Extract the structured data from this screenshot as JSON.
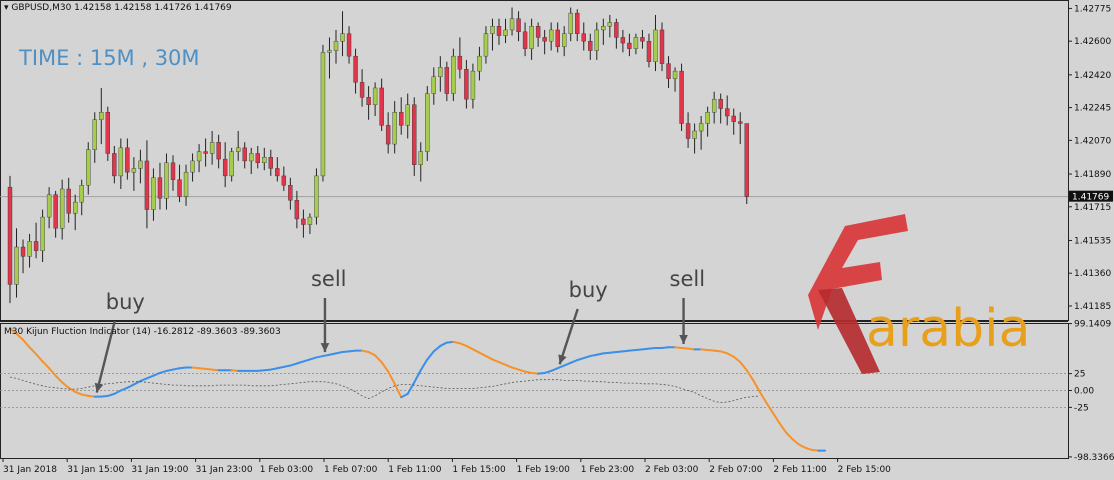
{
  "header": {
    "symbol": "GBPUSD,M30",
    "ohlc": "1.42158 1.42158 1.41726 1.41769"
  },
  "watermark": "TIME : 15M , 30M",
  "logo_text": "arabia",
  "indicator_header": "M30 Kijun Fluction Indicator (14) -16.2812 -89.3603 -89.3603",
  "chart_data": [
    {
      "type": "candlestick",
      "price_ticks": [
        "1.42775",
        "1.42600",
        "1.42420",
        "1.42245",
        "1.42070",
        "1.41890",
        "1.41715",
        "1.41535",
        "1.41360",
        "1.41185"
      ],
      "current_price": "1.41769",
      "ylim": [
        1.4111,
        1.4282
      ],
      "colors": {
        "bull": "#a6cc4e",
        "bear": "#e0354a",
        "wick": "#222222"
      },
      "candles": [
        [
          1.4182,
          1.4188,
          1.412,
          1.413
        ],
        [
          1.413,
          1.416,
          1.4123,
          1.415
        ],
        [
          1.415,
          1.4154,
          1.4136,
          1.4145
        ],
        [
          1.4145,
          1.4157,
          1.4139,
          1.4153
        ],
        [
          1.4153,
          1.4163,
          1.4144,
          1.4148
        ],
        [
          1.4148,
          1.417,
          1.4142,
          1.4166
        ],
        [
          1.4166,
          1.4182,
          1.416,
          1.4178
        ],
        [
          1.4178,
          1.418,
          1.4155,
          1.416
        ],
        [
          1.416,
          1.4186,
          1.4154,
          1.4181
        ],
        [
          1.4181,
          1.4187,
          1.4163,
          1.4168
        ],
        [
          1.4168,
          1.4178,
          1.4159,
          1.4174
        ],
        [
          1.4174,
          1.4186,
          1.4167,
          1.4183
        ],
        [
          1.4183,
          1.4206,
          1.4178,
          1.4202
        ],
        [
          1.4202,
          1.4222,
          1.4195,
          1.4218
        ],
        [
          1.4218,
          1.4235,
          1.4205,
          1.4222
        ],
        [
          1.4222,
          1.4225,
          1.4196,
          1.42
        ],
        [
          1.42,
          1.4204,
          1.4184,
          1.4188
        ],
        [
          1.4188,
          1.4208,
          1.4181,
          1.4203
        ],
        [
          1.4203,
          1.4208,
          1.4186,
          1.419
        ],
        [
          1.419,
          1.4198,
          1.418,
          1.4192
        ],
        [
          1.4192,
          1.4202,
          1.4184,
          1.4196
        ],
        [
          1.4196,
          1.4207,
          1.416,
          1.417
        ],
        [
          1.417,
          1.4192,
          1.4164,
          1.4187
        ],
        [
          1.4187,
          1.4195,
          1.417,
          1.4176
        ],
        [
          1.4176,
          1.42,
          1.417,
          1.4195
        ],
        [
          1.4195,
          1.4199,
          1.418,
          1.4186
        ],
        [
          1.4186,
          1.4194,
          1.4174,
          1.4177
        ],
        [
          1.4177,
          1.4194,
          1.4172,
          1.419
        ],
        [
          1.419,
          1.42,
          1.4185,
          1.4196
        ],
        [
          1.4196,
          1.4205,
          1.419,
          1.4201
        ],
        [
          1.4201,
          1.4208,
          1.4193,
          1.42
        ],
        [
          1.42,
          1.4212,
          1.4194,
          1.4206
        ],
        [
          1.4206,
          1.421,
          1.4192,
          1.4197
        ],
        [
          1.4197,
          1.4206,
          1.4182,
          1.4188
        ],
        [
          1.4188,
          1.4203,
          1.4185,
          1.4201
        ],
        [
          1.4201,
          1.4212,
          1.4196,
          1.4203
        ],
        [
          1.4203,
          1.4206,
          1.4192,
          1.4196
        ],
        [
          1.4196,
          1.4203,
          1.4189,
          1.42
        ],
        [
          1.42,
          1.4204,
          1.4192,
          1.4195
        ],
        [
          1.4195,
          1.4203,
          1.4191,
          1.4198
        ],
        [
          1.4198,
          1.4202,
          1.4188,
          1.4192
        ],
        [
          1.4192,
          1.4198,
          1.4185,
          1.4188
        ],
        [
          1.4188,
          1.4193,
          1.418,
          1.4183
        ],
        [
          1.4183,
          1.4187,
          1.417,
          1.4175
        ],
        [
          1.4175,
          1.418,
          1.416,
          1.4165
        ],
        [
          1.4165,
          1.417,
          1.4155,
          1.4162
        ],
        [
          1.4162,
          1.4168,
          1.4157,
          1.4166
        ],
        [
          1.4166,
          1.4192,
          1.4162,
          1.4188
        ],
        [
          1.4188,
          1.4258,
          1.4185,
          1.4254
        ],
        [
          1.4254,
          1.4262,
          1.424,
          1.4255
        ],
        [
          1.4255,
          1.4266,
          1.4248,
          1.426
        ],
        [
          1.426,
          1.4276,
          1.4252,
          1.4264
        ],
        [
          1.4264,
          1.4268,
          1.4248,
          1.4252
        ],
        [
          1.4252,
          1.4256,
          1.4232,
          1.4238
        ],
        [
          1.4238,
          1.4245,
          1.4225,
          1.423
        ],
        [
          1.423,
          1.4236,
          1.4218,
          1.4226
        ],
        [
          1.4226,
          1.4238,
          1.422,
          1.4235
        ],
        [
          1.4235,
          1.424,
          1.4212,
          1.4215
        ],
        [
          1.4215,
          1.4222,
          1.42,
          1.4205
        ],
        [
          1.4205,
          1.4228,
          1.42,
          1.4222
        ],
        [
          1.4222,
          1.423,
          1.421,
          1.4215
        ],
        [
          1.4215,
          1.4232,
          1.4208,
          1.4226
        ],
        [
          1.4226,
          1.423,
          1.4188,
          1.4194
        ],
        [
          1.4194,
          1.4206,
          1.4185,
          1.4201
        ],
        [
          1.4201,
          1.4236,
          1.4196,
          1.4232
        ],
        [
          1.4232,
          1.4246,
          1.4226,
          1.4241
        ],
        [
          1.4241,
          1.4252,
          1.4233,
          1.4246
        ],
        [
          1.4246,
          1.4249,
          1.4228,
          1.4232
        ],
        [
          1.4232,
          1.4256,
          1.4228,
          1.4252
        ],
        [
          1.4252,
          1.4262,
          1.424,
          1.4245
        ],
        [
          1.4245,
          1.425,
          1.4224,
          1.4229
        ],
        [
          1.4229,
          1.4248,
          1.4224,
          1.4244
        ],
        [
          1.4244,
          1.4257,
          1.4239,
          1.4252
        ],
        [
          1.4252,
          1.4268,
          1.4248,
          1.4264
        ],
        [
          1.4264,
          1.4272,
          1.4255,
          1.4268
        ],
        [
          1.4268,
          1.4272,
          1.4258,
          1.4263
        ],
        [
          1.4263,
          1.4272,
          1.4259,
          1.4266
        ],
        [
          1.4266,
          1.4278,
          1.4263,
          1.4272
        ],
        [
          1.4272,
          1.4276,
          1.426,
          1.4265
        ],
        [
          1.4265,
          1.427,
          1.4252,
          1.4256
        ],
        [
          1.4256,
          1.4272,
          1.425,
          1.4268
        ],
        [
          1.4268,
          1.427,
          1.4257,
          1.4262
        ],
        [
          1.4262,
          1.4266,
          1.4253,
          1.426
        ],
        [
          1.426,
          1.427,
          1.4255,
          1.4266
        ],
        [
          1.4266,
          1.427,
          1.4254,
          1.4257
        ],
        [
          1.4257,
          1.4268,
          1.4252,
          1.4264
        ],
        [
          1.4264,
          1.4278,
          1.426,
          1.4275
        ],
        [
          1.4275,
          1.4277,
          1.426,
          1.4264
        ],
        [
          1.4264,
          1.427,
          1.4255,
          1.426
        ],
        [
          1.426,
          1.4264,
          1.425,
          1.4255
        ],
        [
          1.4255,
          1.427,
          1.425,
          1.4266
        ],
        [
          1.4266,
          1.4272,
          1.4258,
          1.4268
        ],
        [
          1.4268,
          1.4274,
          1.4262,
          1.427
        ],
        [
          1.427,
          1.4272,
          1.4256,
          1.4262
        ],
        [
          1.4262,
          1.4266,
          1.4254,
          1.4259
        ],
        [
          1.4259,
          1.4264,
          1.4252,
          1.4256
        ],
        [
          1.4256,
          1.4264,
          1.4253,
          1.4262
        ],
        [
          1.4262,
          1.4266,
          1.4256,
          1.426
        ],
        [
          1.426,
          1.4264,
          1.4246,
          1.4249
        ],
        [
          1.4249,
          1.4274,
          1.4244,
          1.4266
        ],
        [
          1.4266,
          1.427,
          1.4244,
          1.4248
        ],
        [
          1.4248,
          1.4252,
          1.4235,
          1.424
        ],
        [
          1.424,
          1.4246,
          1.4233,
          1.4244
        ],
        [
          1.4244,
          1.4248,
          1.4212,
          1.4216
        ],
        [
          1.4216,
          1.4222,
          1.4203,
          1.4208
        ],
        [
          1.4208,
          1.4216,
          1.42,
          1.4212
        ],
        [
          1.4212,
          1.422,
          1.4202,
          1.4216
        ],
        [
          1.4216,
          1.4225,
          1.4209,
          1.4222
        ],
        [
          1.4222,
          1.4233,
          1.4216,
          1.4229
        ],
        [
          1.4229,
          1.4232,
          1.4216,
          1.4224
        ],
        [
          1.4224,
          1.4231,
          1.4215,
          1.422
        ],
        [
          1.422,
          1.4224,
          1.421,
          1.4217
        ],
        [
          1.4217,
          1.4222,
          1.4205,
          1.4216
        ],
        [
          1.4216,
          1.4216,
          1.4173,
          1.4177
        ]
      ],
      "time_labels": [
        "31 Jan 2018",
        "31 Jan 15:00",
        "31 Jan 19:00",
        "31 Jan 23:00",
        "1 Feb 03:00",
        "1 Feb 07:00",
        "1 Feb 11:00",
        "1 Feb 15:00",
        "1 Feb 19:00",
        "1 Feb 23:00",
        "2 Feb 03:00",
        "2 Feb 07:00",
        "2 Feb 11:00",
        "2 Feb 15:00"
      ]
    },
    {
      "type": "line",
      "ylim": [
        -100,
        100
      ],
      "y_ticks": [
        "99.1409",
        "25",
        "0.00",
        "-25",
        "-98.3366"
      ],
      "series": [
        {
          "color": "#3a8fe8",
          "values": []
        },
        {
          "color": "#f5922a",
          "values": []
        },
        {
          "color": "#555555",
          "dash": true,
          "values": []
        }
      ],
      "kijun_values": [
        92,
        84,
        75,
        64,
        54,
        43,
        33,
        22,
        12,
        4,
        -2,
        -6,
        -8,
        -9,
        -9,
        -8,
        -5,
        0,
        4,
        9,
        14,
        18,
        22,
        26,
        29,
        31,
        33,
        34,
        34,
        33,
        32,
        31,
        30,
        30,
        30,
        29,
        29,
        29,
        29,
        30,
        31,
        33,
        35,
        37,
        40,
        43,
        46,
        49,
        51,
        53,
        55,
        57,
        58,
        59,
        59,
        57,
        52,
        42,
        28,
        10,
        -10,
        -5,
        12,
        30,
        46,
        58,
        66,
        71,
        72,
        70,
        66,
        61,
        56,
        51,
        46,
        42,
        38,
        34,
        31,
        28,
        26,
        25,
        26,
        29,
        33,
        37,
        41,
        45,
        48,
        51,
        53,
        55,
        56,
        57,
        58,
        59,
        60,
        61,
        62,
        63,
        63,
        64,
        64,
        63,
        62,
        61,
        61,
        60,
        59,
        58,
        55,
        50,
        42,
        30,
        15,
        -2,
        -18,
        -33,
        -48,
        -62,
        -72,
        -80,
        -85,
        -88,
        -89,
        -89
      ],
      "signal_values": [
        20,
        18,
        15,
        12,
        9,
        7,
        5,
        4,
        3,
        2,
        2,
        3,
        5,
        7,
        9,
        10,
        11,
        12,
        13,
        13,
        13,
        12,
        11,
        10,
        9,
        8,
        8,
        7,
        7,
        7,
        7,
        7,
        8,
        8,
        8,
        8,
        8,
        7,
        7,
        7,
        7,
        8,
        9,
        10,
        11,
        12,
        13,
        13,
        13,
        12,
        10,
        7,
        3,
        -2,
        -8,
        -12,
        -8,
        -2,
        3,
        7,
        9,
        9,
        8,
        7,
        6,
        5,
        4,
        3,
        3,
        3,
        3,
        3,
        4,
        5,
        6,
        8,
        10,
        12,
        13,
        14,
        15,
        16,
        16,
        16,
        16,
        15,
        15,
        15,
        14,
        14,
        13,
        13,
        12,
        12,
        11,
        11,
        11,
        10,
        10,
        10,
        9,
        8,
        6,
        3,
        0,
        -3,
        -8,
        -12,
        -16,
        -18,
        -17,
        -15,
        -12,
        -10,
        -9,
        -8
      ],
      "annotations": [
        {
          "label": "buy",
          "index": 13
        },
        {
          "label": "sell",
          "index": 48
        },
        {
          "label": "buy",
          "index": 84
        },
        {
          "label": "sell",
          "index": 103
        }
      ]
    }
  ]
}
